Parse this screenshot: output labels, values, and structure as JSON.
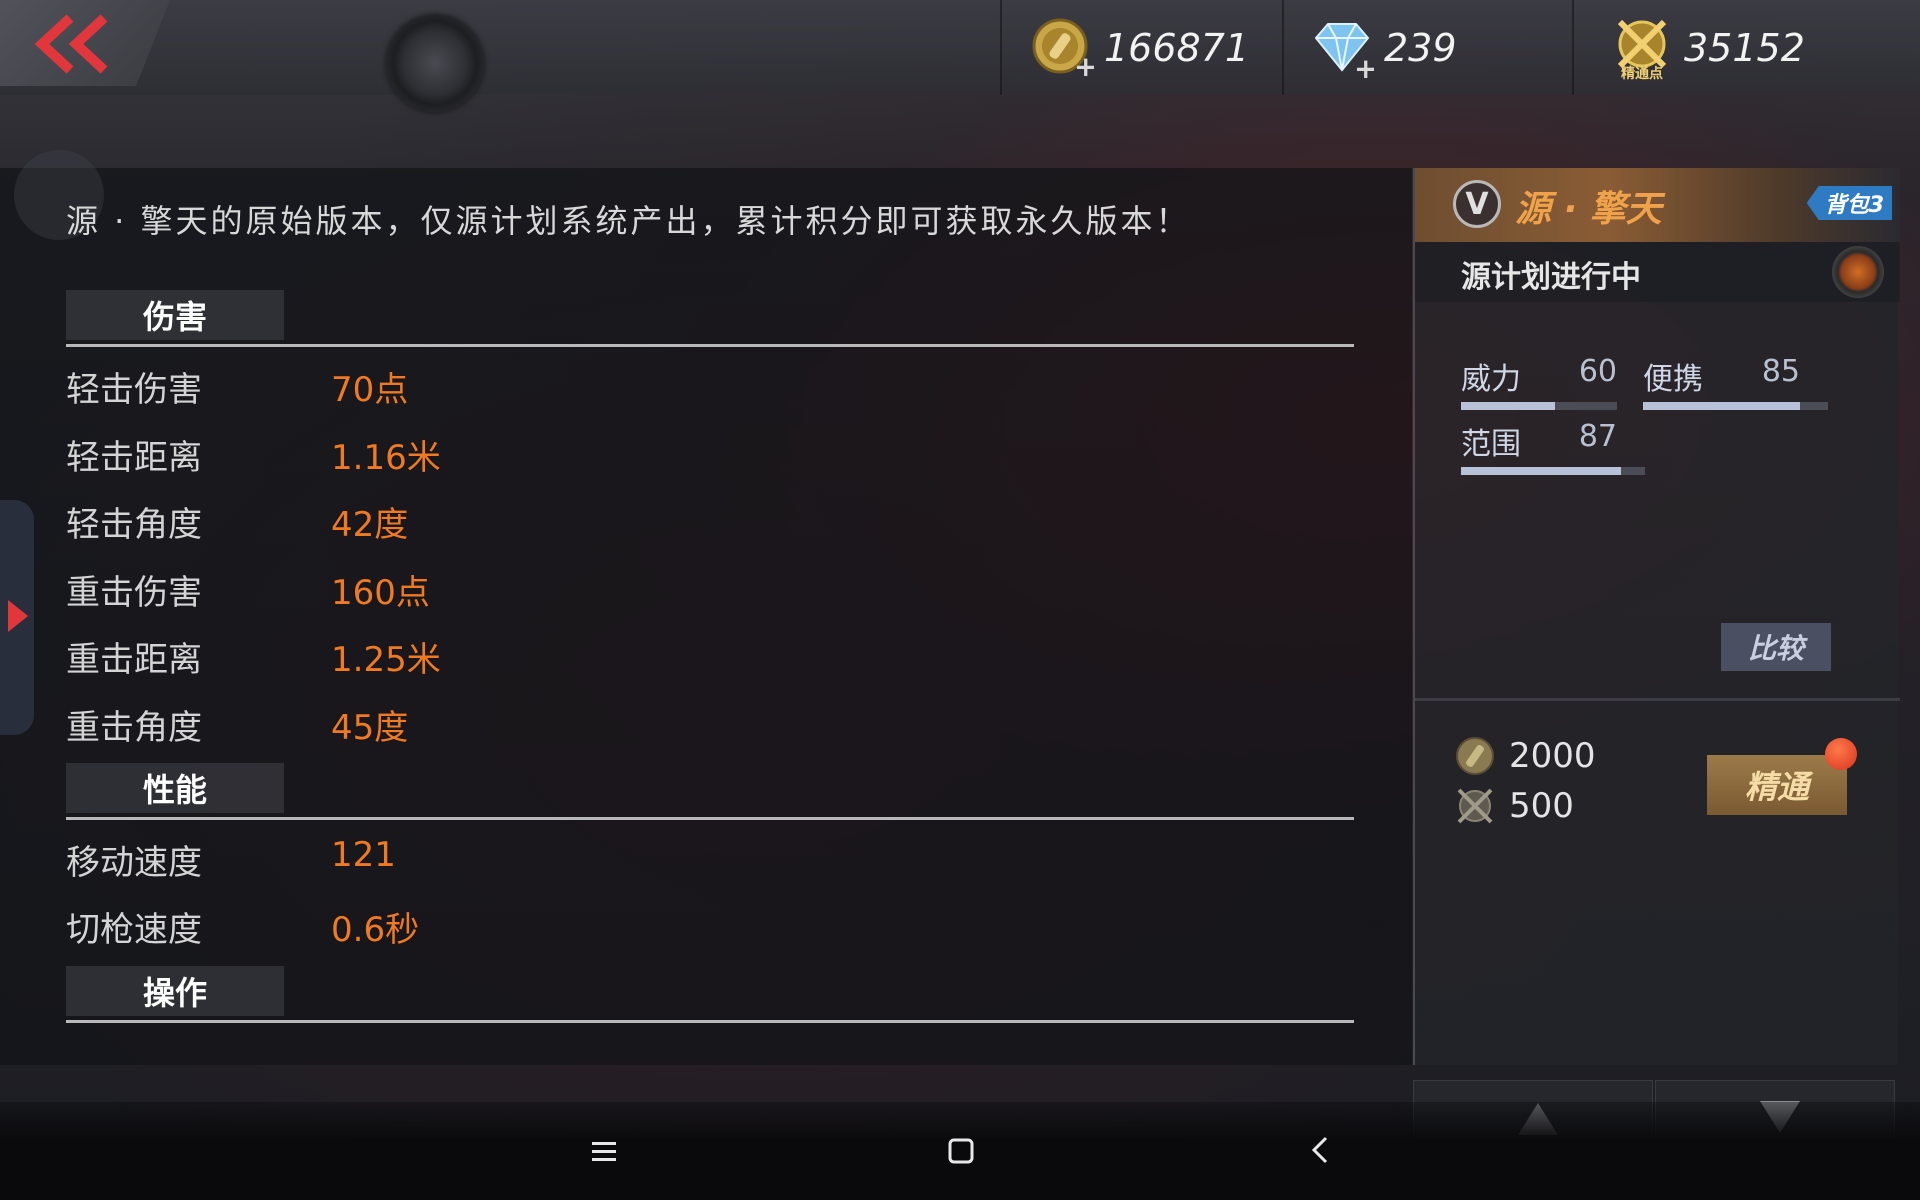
{
  "header": {
    "currencies": [
      {
        "name": "gold-coin-icon",
        "value": "166871"
      },
      {
        "name": "diamond-icon",
        "value": "239"
      },
      {
        "name": "mastery-points-icon",
        "value": "35152"
      }
    ],
    "mastery_icon_caption": "精通点"
  },
  "description": "源 · 擎天的原始版本，仅源计划系统产出，累计积分即可获取永久版本！",
  "sections": {
    "damage": {
      "title": "伤害",
      "rows": [
        {
          "name": "轻击伤害",
          "value": "70点"
        },
        {
          "name": "轻击距离",
          "value": "1.16米"
        },
        {
          "name": "轻击角度",
          "value": "42度"
        },
        {
          "name": "重击伤害",
          "value": "160点"
        },
        {
          "name": "重击距离",
          "value": "1.25米"
        },
        {
          "name": "重击角度",
          "value": "45度"
        }
      ]
    },
    "performance": {
      "title": "性能",
      "rows": [
        {
          "name": "移动速度",
          "value": "121"
        },
        {
          "name": "切枪速度",
          "value": "0.6秒"
        }
      ]
    },
    "operation": {
      "title": "操作"
    }
  },
  "weapon": {
    "badge": "V",
    "name": "源 · 擎天",
    "bag_tag": "背包3",
    "plan_status": "源计划进行中",
    "stats": [
      {
        "label": "威力",
        "value": "60"
      },
      {
        "label": "便携",
        "value": "85"
      },
      {
        "label": "范围",
        "value": "87"
      }
    ],
    "compare_label": "比较",
    "costs": [
      {
        "icon": "gold-coin-icon",
        "value": "2000"
      },
      {
        "icon": "mastery-points-icon",
        "value": "500"
      }
    ],
    "master_label": "精通"
  },
  "colors": {
    "stat_value": "#f07a22",
    "weapon_name": "#f0a24a",
    "bag_tag": "#2e7bc4",
    "notify": "#d8321e"
  }
}
